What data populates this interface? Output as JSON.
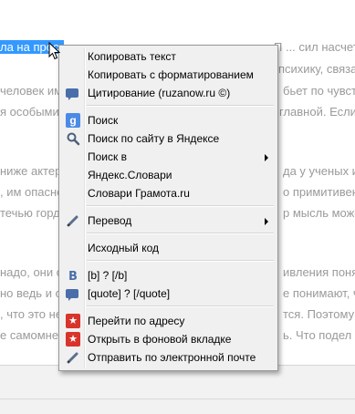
{
  "article": {
    "line1_selected": "ла на прост",
    "line1_rest_hidden": "",
    "line1_right": "П  ...  сил насчет прос",
    "line2_right": "психику, связанную с ...  психику, поня",
    "line3_left": "человек им",
    "line3_right": "бьет по чувств",
    "line4_left": "я особыми",
    "line4_right": "главной. Если",
    "line5_left": "ниже актер",
    "line5_right": "да у ученых и п",
    "line6_left": ", им опасно",
    "line6_right": "о примитивен.",
    "line7_left": "течью горд",
    "line7_right": "р мысль може",
    "line8_left": "надо, они ск",
    "line8_right": "ивления поняти",
    "line9_left": "но ведь и он",
    "line9_right": "е понимают, что",
    "line10_left": ", что это не",
    "line10_right": "тся. Поэтому сн",
    "line11_left": "е самомнен",
    "line11_right": "ь. Что подел"
  },
  "menu": {
    "items": [
      {
        "label": "Копировать текст"
      },
      {
        "label": "Копировать с форматированием"
      },
      {
        "label": "Цитирование (ruzanow.ru ©)"
      },
      {
        "label": "Поиск"
      },
      {
        "label": "Поиск по сайту в Яндексе"
      },
      {
        "label": "Поиск в"
      },
      {
        "label": "Яндекс.Словари"
      },
      {
        "label": "Словари Грамота.ru"
      },
      {
        "label": "Перевод"
      },
      {
        "label": "Исходный код"
      },
      {
        "label": "[b] ? [/b]"
      },
      {
        "label": "[quote] ? [/quote]"
      },
      {
        "label": "Перейти по адресу"
      },
      {
        "label": "Открыть в фоновой вкладке"
      },
      {
        "label": "Отправить по электронной почте"
      }
    ],
    "icons": {
      "google_glyph": "g",
      "star_glyph": "★"
    }
  }
}
